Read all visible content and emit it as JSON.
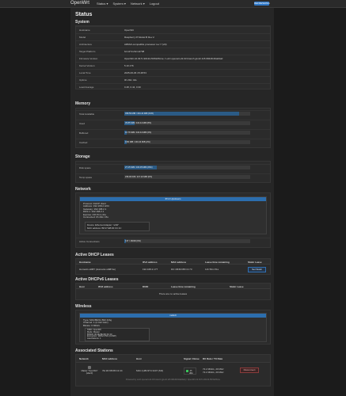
{
  "app": {
    "brand": "OpenWrt",
    "nav": [
      "Status ▾",
      "System ▾",
      "Network ▾",
      "Logout"
    ],
    "refresh_label": "REFRESHING"
  },
  "page": {
    "title": "Status",
    "sections": {
      "system": "System",
      "memory": "Memory",
      "storage": "Storage",
      "network": "Network",
      "dhcp": "Active DHCP Leases",
      "dhcpv6": "Active DHCPv6 Leases",
      "wireless": "Wireless",
      "stations": "Associated Stations"
    }
  },
  "system": [
    {
      "k": "Hostname",
      "v": "OpenWrt"
    },
    {
      "k": "Model",
      "v": "Raspberry Pi Model B Rev 2"
    },
    {
      "k": "Architecture",
      "v": "ARMv6-compatible processor rev 7 (v6l)"
    },
    {
      "k": "Target Platform",
      "v": "bcm27xx/bcm2708"
    },
    {
      "k": "Firmware Version",
      "v": "OpenWrt 22.03.5 r20134-5f15225c1e / LuCI openwrt-22.03 branch git-22.115.68448-60ab6a0"
    },
    {
      "k": "Kernel Version",
      "v": "5.10.176"
    },
    {
      "k": "Local Time",
      "v": "2025-06-06 15:48:53"
    },
    {
      "k": "Uptime",
      "v": "0h 20m 44s"
    },
    {
      "k": "Load Average",
      "v": "0.48, 0.44, 0.30"
    }
  ],
  "memory": [
    {
      "k": "Total Available",
      "v": "398.59 MiB / 434.44 MiB (91%)",
      "pct": 0.91
    },
    {
      "k": "Used",
      "v": "35.85 MiB / 434.44 MiB (8%)",
      "pct": 0.08
    },
    {
      "k": "Buffered",
      "v": "10.76 MiB / 434.44 MiB (2%)",
      "pct": 0.02
    },
    {
      "k": "Cached",
      "v": "9.80 MiB / 434.44 MiB (2%)",
      "pct": 0.02
    }
  ],
  "storage": [
    {
      "k": "Disk space",
      "v": "27.15 MiB / 103.35 MiB (26%)",
      "pct": 0.26
    },
    {
      "k": "Temp space",
      "v": "236.00 KiB / 217.22 MiB (0%)",
      "pct": 0.0
    }
  ],
  "network": {
    "badge": "IPv4 Upstream",
    "lines": [
      "Protocol: DHCP client",
      "Address: 192.168.2.4/24",
      "Gateway: 192.168.2.1",
      "DNS 1: 192.168.2.1",
      "Expires: 23h 51m 41s",
      "Connected: 0h 20m 15s"
    ],
    "device_line1": "Device: Ethernet Adapter: \"eth0\"",
    "device_line2": "MAC address: B8:27:EB:00:CC:1C",
    "active_conn_label": "Active Connections",
    "active_conn_value": "137 / 16000 (0%)",
    "active_conn_pct": 0.01
  },
  "dhcp": {
    "headers": [
      "Hostname",
      "IPv4 address",
      "MAC address",
      "Lease time remaining",
      "Static Lease"
    ],
    "rows": [
      {
        "host": "Humanix-H987 (Humanix-H987ax)",
        "ip": "192.168.2.177",
        "mac": "DC:1B:6D:88:C1:73",
        "lease": "11h 59m 51s",
        "action": "Set Static"
      }
    ]
  },
  "dhcpv6": {
    "headers": [
      "Host",
      "IPv6 address",
      "DUID",
      "Lease time remaining",
      "Static Lease"
    ],
    "empty": "There are no active leases"
  },
  "wireless": {
    "badge": "radio0",
    "lines": [
      "Type: MAC80211 802.11bg",
      "Channel: 1 (2.412 GHz)",
      "Bitrate: 6 Mbit/s"
    ],
    "ssid_lines": [
      "SSID: OpenWrt",
      "Mode: Master",
      "BSSID: 00:0E:8E:DF:FC:1F",
      "Encryption: WPA2 PSK (CCMP)",
      "Associations: 1"
    ]
  },
  "stations": {
    "headers": [
      "Network",
      "MAC address",
      "Host",
      "Signal / Noise",
      "RX Rate / TX Rate",
      ""
    ],
    "rows": [
      {
        "network": "Master \"OpenWrt\" (wlan0)",
        "mac": "7E:1D:98:08:C2:44",
        "host": "MAC (H8C3T4 3447 (M4)",
        "signal": "-45 dBm",
        "rx": "72.2 Mbit/s, 20 MHz",
        "tx": "72.2 Mbit/s, 20 MHz",
        "action": "Disconnect"
      }
    ]
  },
  "footer": "Powered by LuCI openwrt-22.03 branch (git-22.115.68448-60ab6a0) / OpenWrt 22.03.5 r20134-5f15225c1e"
}
